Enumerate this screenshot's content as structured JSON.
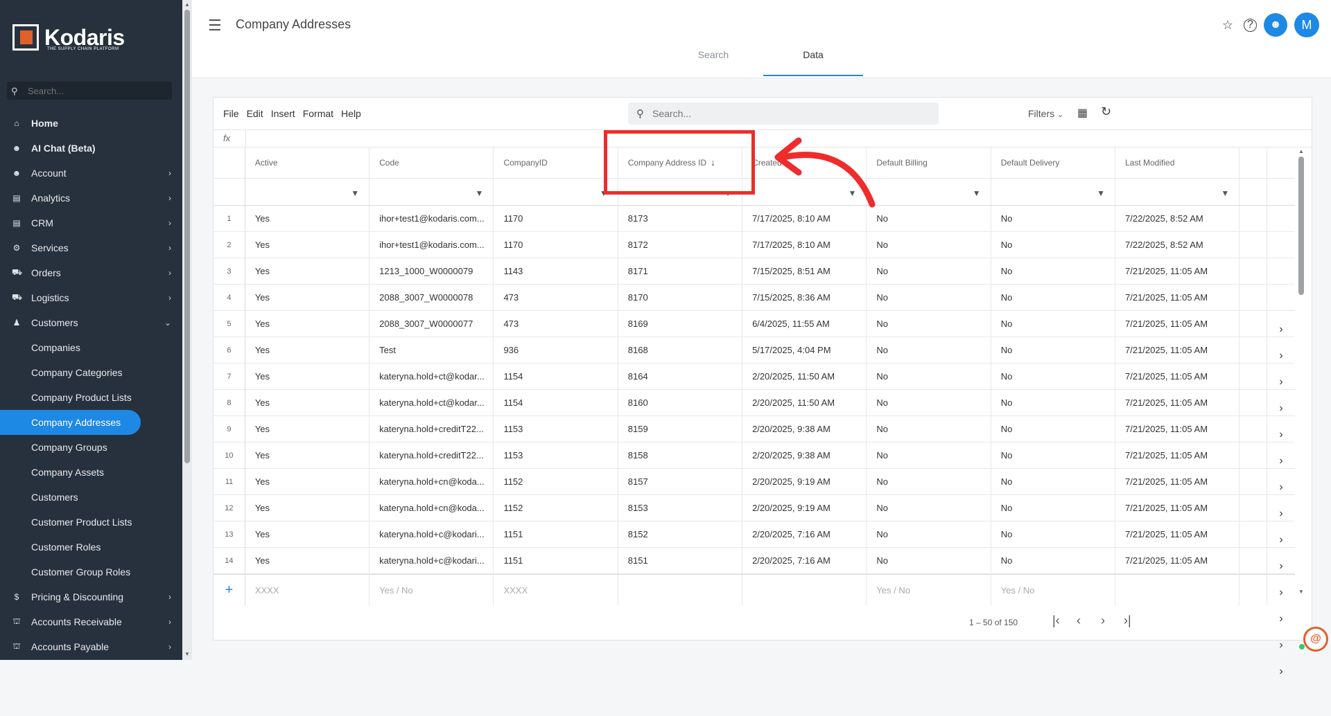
{
  "brand": {
    "name": "Kodaris",
    "tagline": "THE SUPPLY CHAIN PLATFORM",
    "accent": "#e35f2a",
    "primary": "#1e88e5"
  },
  "sidebar": {
    "search_placeholder": "Search...",
    "items": [
      {
        "label": "Home",
        "icon": "home-icon",
        "bold": true
      },
      {
        "label": "AI Chat (Beta)",
        "icon": "robot-icon",
        "bold": true
      },
      {
        "label": "Account",
        "icon": "person-icon",
        "chevron": true
      },
      {
        "label": "Analytics",
        "icon": "chart-icon",
        "chevron": true
      },
      {
        "label": "CRM",
        "icon": "contact-card-icon",
        "chevron": true
      },
      {
        "label": "Services",
        "icon": "gears-icon",
        "chevron": true
      },
      {
        "label": "Orders",
        "icon": "truck-icon",
        "chevron": true
      },
      {
        "label": "Logistics",
        "icon": "shipping-icon",
        "chevron": true
      },
      {
        "label": "Customers",
        "icon": "people-icon",
        "chevron": true,
        "expanded": true
      }
    ],
    "subitems": [
      {
        "label": "Companies"
      },
      {
        "label": "Company Categories"
      },
      {
        "label": "Company Product Lists"
      },
      {
        "label": "Company Addresses",
        "active": true
      },
      {
        "label": "Company Groups"
      },
      {
        "label": "Company Assets"
      },
      {
        "label": "Customers"
      },
      {
        "label": "Customer Product Lists"
      },
      {
        "label": "Customer Roles"
      },
      {
        "label": "Customer Group Roles"
      }
    ],
    "items_after": [
      {
        "label": "Pricing & Discounting",
        "icon": "dollar-icon",
        "chevron": true
      },
      {
        "label": "Accounts Receivable",
        "icon": "bank-icon",
        "chevron": true
      },
      {
        "label": "Accounts Payable",
        "icon": "bank-icon",
        "chevron": true
      }
    ]
  },
  "header": {
    "title": "Company Addresses",
    "avatar_initial": "M"
  },
  "tabs": [
    {
      "label": "Search"
    },
    {
      "label": "Data",
      "active": true
    }
  ],
  "toolbar": {
    "menus": [
      "File",
      "Edit",
      "Insert",
      "Format",
      "Help"
    ],
    "search_placeholder": "Search...",
    "filters_label": "Filters",
    "fx_label": "fx"
  },
  "table": {
    "columns": [
      "Active",
      "Code",
      "CompanyID",
      "Company Address ID",
      "Created",
      "Default Billing",
      "Default Delivery",
      "Last Modified"
    ],
    "sorted_column": "Company Address ID",
    "rows": [
      [
        "1",
        "Yes",
        "ihor+test1@kodaris.com...",
        "1170",
        "8173",
        "7/17/2025, 8:10 AM",
        "No",
        "No",
        "7/22/2025, 8:52 AM"
      ],
      [
        "2",
        "Yes",
        "ihor+test1@kodaris.com...",
        "1170",
        "8172",
        "7/17/2025, 8:10 AM",
        "No",
        "No",
        "7/22/2025, 8:52 AM"
      ],
      [
        "3",
        "Yes",
        "1213_1000_W0000079",
        "1143",
        "8171",
        "7/15/2025, 8:51 AM",
        "No",
        "No",
        "7/21/2025, 11:05 AM"
      ],
      [
        "4",
        "Yes",
        "2088_3007_W0000078",
        "473",
        "8170",
        "7/15/2025, 8:36 AM",
        "No",
        "No",
        "7/21/2025, 11:05 AM"
      ],
      [
        "5",
        "Yes",
        "2088_3007_W0000077",
        "473",
        "8169",
        "6/4/2025, 11:55 AM",
        "No",
        "No",
        "7/21/2025, 11:05 AM"
      ],
      [
        "6",
        "Yes",
        "Test",
        "936",
        "8168",
        "5/17/2025, 4:04 PM",
        "No",
        "No",
        "7/21/2025, 11:05 AM"
      ],
      [
        "7",
        "Yes",
        "kateryna.hold+ct@kodar...",
        "1154",
        "8164",
        "2/20/2025, 11:50 AM",
        "No",
        "No",
        "7/21/2025, 11:05 AM"
      ],
      [
        "8",
        "Yes",
        "kateryna.hold+ct@kodar...",
        "1154",
        "8160",
        "2/20/2025, 11:50 AM",
        "No",
        "No",
        "7/21/2025, 11:05 AM"
      ],
      [
        "9",
        "Yes",
        "kateryna.hold+creditT22...",
        "1153",
        "8159",
        "2/20/2025, 9:38 AM",
        "No",
        "No",
        "7/21/2025, 11:05 AM"
      ],
      [
        "10",
        "Yes",
        "kateryna.hold+creditT22...",
        "1153",
        "8158",
        "2/20/2025, 9:38 AM",
        "No",
        "No",
        "7/21/2025, 11:05 AM"
      ],
      [
        "11",
        "Yes",
        "kateryna.hold+cn@koda...",
        "1152",
        "8157",
        "2/20/2025, 9:19 AM",
        "No",
        "No",
        "7/21/2025, 11:05 AM"
      ],
      [
        "12",
        "Yes",
        "kateryna.hold+cn@koda...",
        "1152",
        "8153",
        "2/20/2025, 9:19 AM",
        "No",
        "No",
        "7/21/2025, 11:05 AM"
      ],
      [
        "13",
        "Yes",
        "kateryna.hold+c@kodari...",
        "1151",
        "8152",
        "2/20/2025, 7:16 AM",
        "No",
        "No",
        "7/21/2025, 11:05 AM"
      ],
      [
        "14",
        "Yes",
        "kateryna.hold+c@kodari...",
        "1151",
        "8151",
        "2/20/2025, 7:16 AM",
        "No",
        "No",
        "7/21/2025, 11:05 AM"
      ]
    ],
    "new_row": [
      "XXXX",
      "Yes / No",
      "XXXX",
      "",
      "",
      "Yes / No",
      "Yes / No",
      ""
    ],
    "pagination": "1 – 50 of 150"
  },
  "annotation": {
    "color": "#ee2c2c"
  }
}
